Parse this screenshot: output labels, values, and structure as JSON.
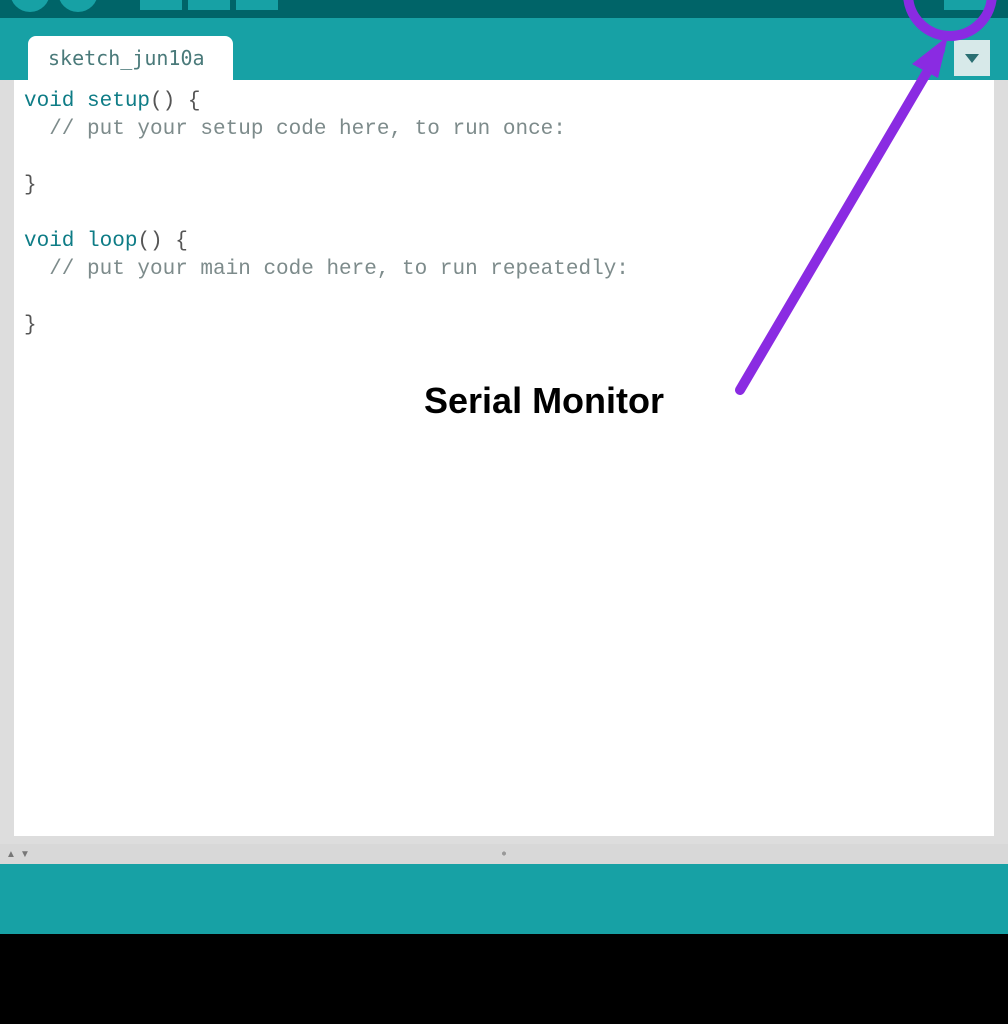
{
  "colors": {
    "toolbar_bg": "#006468",
    "accent": "#17a1a5",
    "annotation": "#8a2be2"
  },
  "tab": {
    "name": "sketch_jun10a"
  },
  "code": {
    "kw_void1": "void",
    "fn_setup": " setup",
    "parens1": "() {",
    "comment_setup": "  // put your setup code here, to run once:",
    "blank1": "",
    "close1": "}",
    "blank2": "",
    "kw_void2": "void",
    "fn_loop": " loop",
    "parens2": "() {",
    "comment_loop": "  // put your main code here, to run repeatedly:",
    "blank3": "",
    "close2": "}"
  },
  "annotation": {
    "label": "Serial Monitor"
  }
}
